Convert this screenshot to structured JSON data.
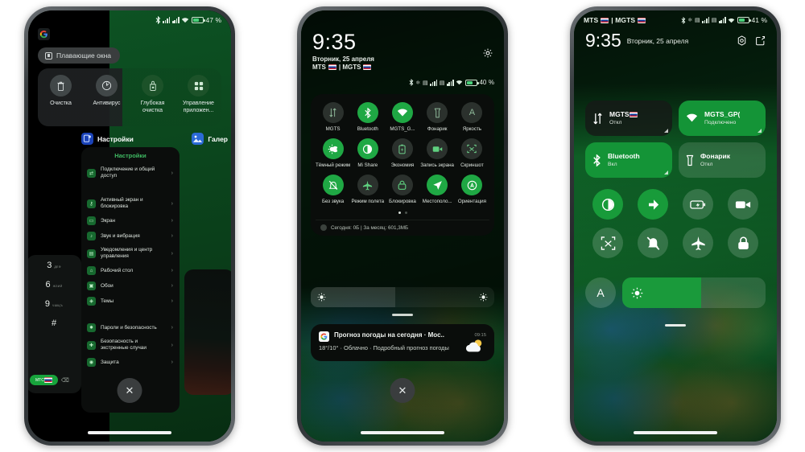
{
  "phone1": {
    "status_bar": {
      "battery": "47",
      "icons": [
        "bluetooth-icon",
        "signal-bars-icon",
        "signal-bars-icon",
        "wifi-icon",
        "battery-icon"
      ]
    },
    "floating_chip": {
      "label": "Плавающие окна",
      "icon": "floating-window-icon"
    },
    "toolbar": [
      {
        "label": "Очистка",
        "icon": "trash-icon"
      },
      {
        "label": "Антивирус",
        "icon": "shield-scan-icon"
      },
      {
        "label": "Глубокая очистка",
        "icon": "deep-clean-icon"
      },
      {
        "label": "Управление приложен...",
        "icon": "app-grid-icon"
      }
    ],
    "cards": [
      {
        "app": "Настройки",
        "icon": "settings-app-icon"
      },
      {
        "app": "Галер",
        "icon": "gallery-app-icon"
      }
    ],
    "settings_card": {
      "title": "Настройки",
      "items": [
        {
          "label": "Подключение и общий доступ",
          "icon": "connection-icon"
        },
        {
          "label": "Активный экран и блокировка",
          "icon": "lock-icon"
        },
        {
          "label": "Экран",
          "icon": "display-icon"
        },
        {
          "label": "Звук и вибрация",
          "icon": "sound-icon"
        },
        {
          "label": "Уведомления и центр управления",
          "icon": "notifications-icon"
        },
        {
          "label": "Рабочий стол",
          "icon": "home-screen-icon"
        },
        {
          "label": "Обои",
          "icon": "wallpaper-icon"
        },
        {
          "label": "Темы",
          "icon": "themes-icon"
        },
        {
          "label": "Пароли и безопасность",
          "icon": "password-icon"
        },
        {
          "label": "Безопасность и экстренные случаи",
          "icon": "emergency-icon"
        },
        {
          "label": "Защита",
          "icon": "protection-icon"
        }
      ],
      "chevron": "›"
    },
    "dialer": [
      {
        "num": "3",
        "sub": "ДЕФ"
      },
      {
        "num": "6",
        "sub": "ЖЗИЙ"
      },
      {
        "num": "9",
        "sub": "ЧШЩЪ"
      },
      {
        "num": "#",
        "sub": ""
      }
    ],
    "close_button": "✕"
  },
  "phone2": {
    "clock": "9:35",
    "date": "Вторник, 25 апреля",
    "carriers": "MTS | MGTS",
    "battery": "40",
    "gear_icon": "gear-icon",
    "quick_settings": {
      "tiles": [
        {
          "label": "MGTS",
          "icon": "mobile-data-icon",
          "state": "off"
        },
        {
          "label": "Bluetooth",
          "icon": "bluetooth-icon",
          "state": "on"
        },
        {
          "label": "MGTS_G...",
          "icon": "wifi-icon",
          "state": "on"
        },
        {
          "label": "Фонарик",
          "icon": "flashlight-icon",
          "state": "off"
        },
        {
          "label": "Яркость",
          "icon": "auto-brightness-icon",
          "state": "off"
        },
        {
          "label": "Тёмный режим",
          "icon": "dark-mode-icon",
          "state": "on"
        },
        {
          "label": "Mi Share",
          "icon": "mi-share-icon",
          "state": "on"
        },
        {
          "label": "Экономия",
          "icon": "battery-saver-icon",
          "state": "off"
        },
        {
          "label": "Запись экрана",
          "icon": "screen-record-icon",
          "state": "off"
        },
        {
          "label": "Скриншот",
          "icon": "screenshot-icon",
          "state": "off"
        },
        {
          "label": "Без звука",
          "icon": "mute-icon",
          "state": "on"
        },
        {
          "label": "Режим полета",
          "icon": "airplane-icon",
          "state": "off"
        },
        {
          "label": "Блокировка",
          "icon": "lock-icon",
          "state": "off"
        },
        {
          "label": "Местополо...",
          "icon": "location-icon",
          "state": "on"
        },
        {
          "label": "Ориентация",
          "icon": "rotation-icon",
          "state": "on"
        }
      ],
      "page_dots": 2,
      "active_dot": 1,
      "data_usage": "Сегодня: 0Б   |   За месяц: 601,3МБ"
    },
    "notification": {
      "title": "Прогноз погоды на сегодня · Мос..",
      "time": "09:15",
      "body": "18°/10° · Облачно · Подробный прогноз погоды",
      "app_icon": "google-icon",
      "weather_icon": "partly-cloudy-icon"
    },
    "close_button": "✕"
  },
  "phone3": {
    "carriers": "MTS | MGTS",
    "battery": "41",
    "clock": "9:35",
    "date": "Вторник, 25 апреля",
    "header_icons": [
      "settings-gear-icon",
      "edit-icon"
    ],
    "tiles": [
      {
        "name": "MGTS",
        "state": "Откл",
        "icon": "mobile-data-icon",
        "style": "dark"
      },
      {
        "name": "MGTS_GP(",
        "state": "Подключено",
        "icon": "wifi-icon",
        "style": "on"
      },
      {
        "name": "Bluetooth",
        "state": "Вкл",
        "icon": "bluetooth-icon",
        "style": "on"
      },
      {
        "name": "Фонарик",
        "state": "Откл",
        "icon": "flashlight-icon",
        "style": "off"
      }
    ],
    "circles": [
      {
        "icon": "dark-mode-icon",
        "state": "on"
      },
      {
        "icon": "mi-share-icon",
        "state": "on"
      },
      {
        "icon": "battery-saver-icon",
        "state": "off"
      },
      {
        "icon": "screen-record-icon",
        "state": "off"
      },
      {
        "icon": "screenshot-icon",
        "state": "off"
      },
      {
        "icon": "mute-icon",
        "state": "off"
      },
      {
        "icon": "airplane-icon",
        "state": "off"
      },
      {
        "icon": "lock-icon",
        "state": "off"
      }
    ],
    "auto_brightness": "A",
    "brightness_icon": "brightness-icon"
  },
  "colors": {
    "accent_green": "#1fa844",
    "tile_green": "#149437",
    "panel_dark": "#0a0d0b",
    "text_primary": "#ffffff",
    "text_secondary": "#dfe8e0"
  }
}
